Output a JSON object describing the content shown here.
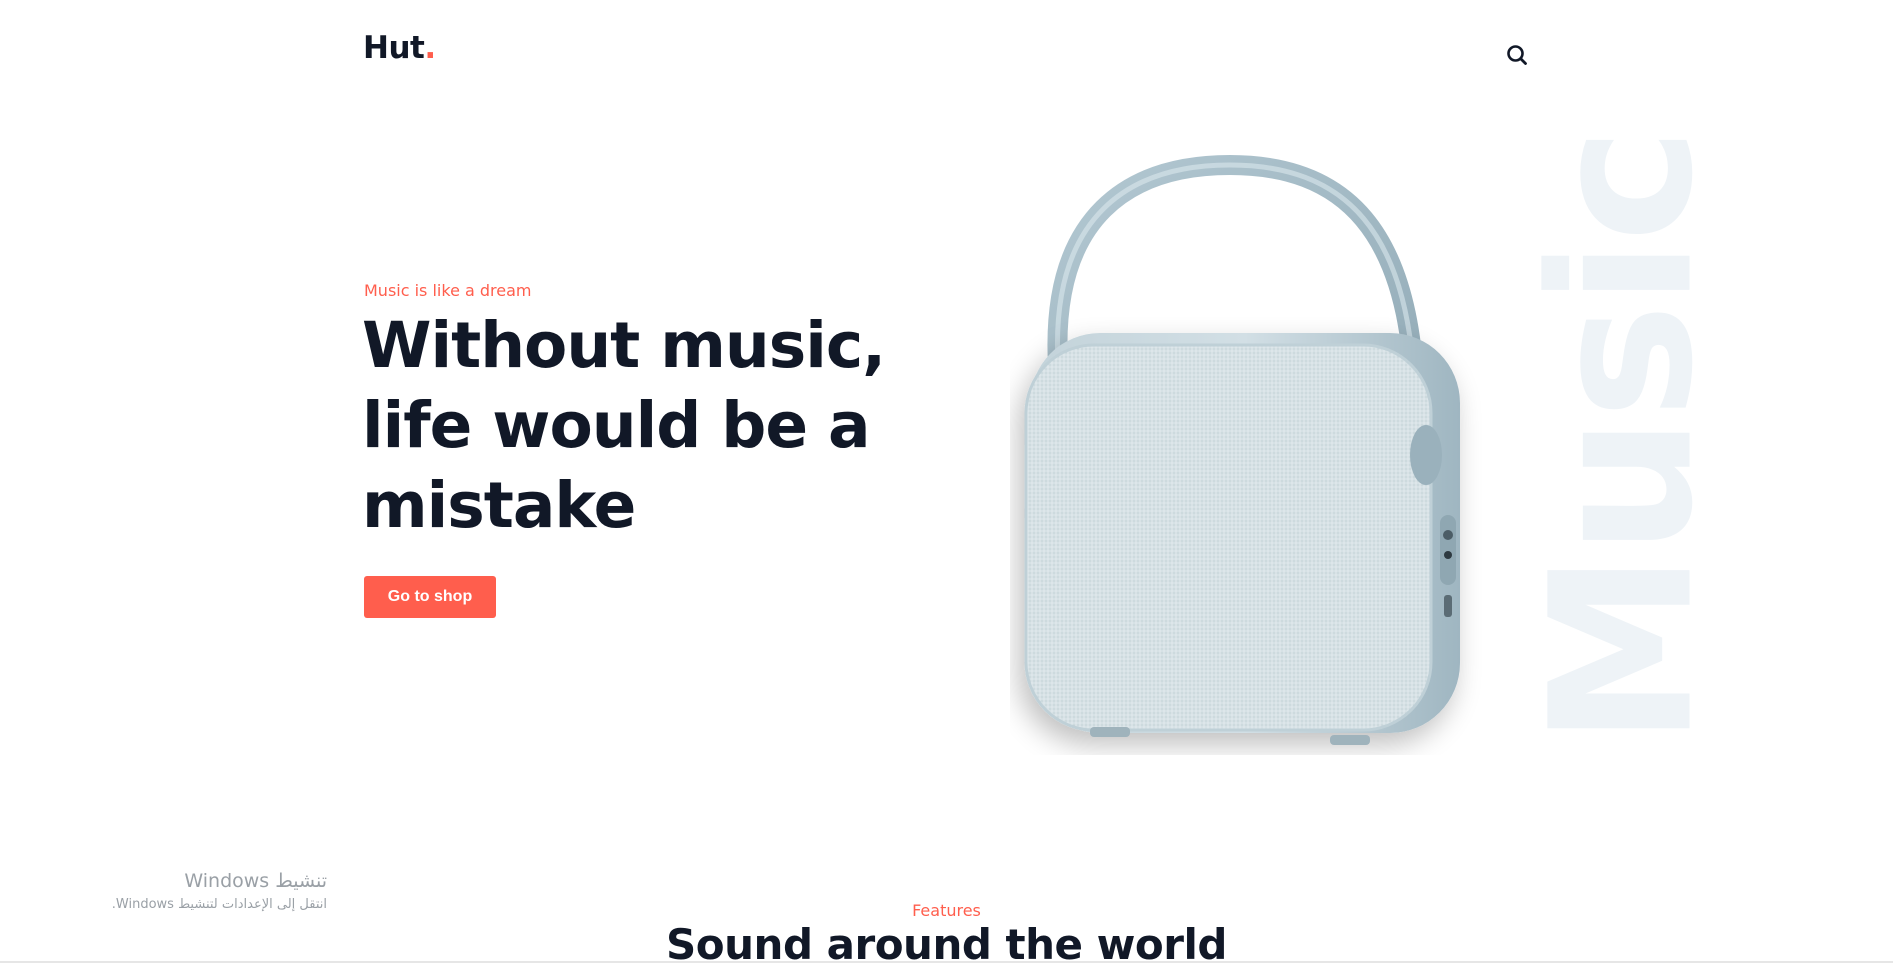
{
  "header": {
    "logo_text": "Hut",
    "logo_dot": ".",
    "search_icon": "search-icon"
  },
  "hero": {
    "subtitle": "Music is like a dream",
    "title_lines": [
      "Without music,",
      "life would be a",
      "mistake"
    ],
    "cta_label": "Go to shop",
    "watermark": "Music",
    "image": "portable-speaker-image"
  },
  "features": {
    "subtitle": "Features",
    "title": "Sound around the world"
  },
  "os_overlay": {
    "activate_title": "تنشيط Windows",
    "activate_hint": "انتقل إلى الإعدادات لتنشيط Windows."
  },
  "colors": {
    "accent": "#ff5e4d",
    "heading": "#111827",
    "watermark": "#eef3f7",
    "speaker_body": "#a9c0cb"
  }
}
